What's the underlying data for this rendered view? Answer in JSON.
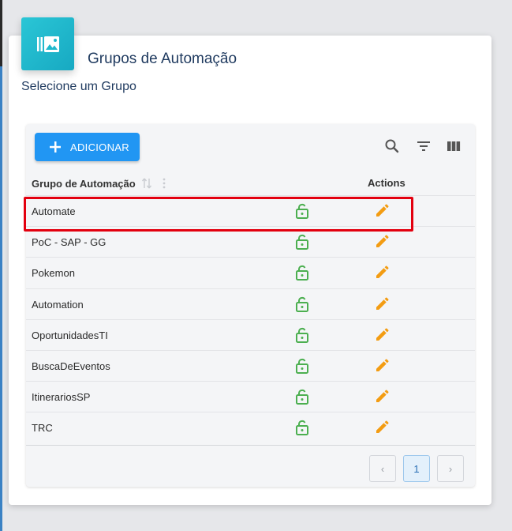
{
  "header": {
    "title": "Grupos de Automação",
    "subtitle": "Selecione um Grupo",
    "icon": "library-photos-icon"
  },
  "toolbar": {
    "add_label": "ADICIONAR",
    "icons": [
      "search-icon",
      "filter-icon",
      "columns-icon"
    ]
  },
  "table": {
    "columns": [
      "Grupo de Automação",
      "Actions"
    ],
    "rows": [
      {
        "name": "Automate"
      },
      {
        "name": "PoC - SAP - GG"
      },
      {
        "name": "Pokemon"
      },
      {
        "name": "Automation"
      },
      {
        "name": "OportunidadesTI"
      },
      {
        "name": "BuscaDeEventos"
      },
      {
        "name": "ItinerariosSP"
      },
      {
        "name": "TRC"
      }
    ],
    "highlighted_row": "Automate"
  },
  "pagination": {
    "prev": "‹",
    "current": "1",
    "next": "›"
  },
  "colors": {
    "accent": "#2196f3",
    "icon_bg": "#1fb8cc",
    "lock": "#4caf50",
    "edit": "#f39c12",
    "highlight": "#e3000f"
  }
}
